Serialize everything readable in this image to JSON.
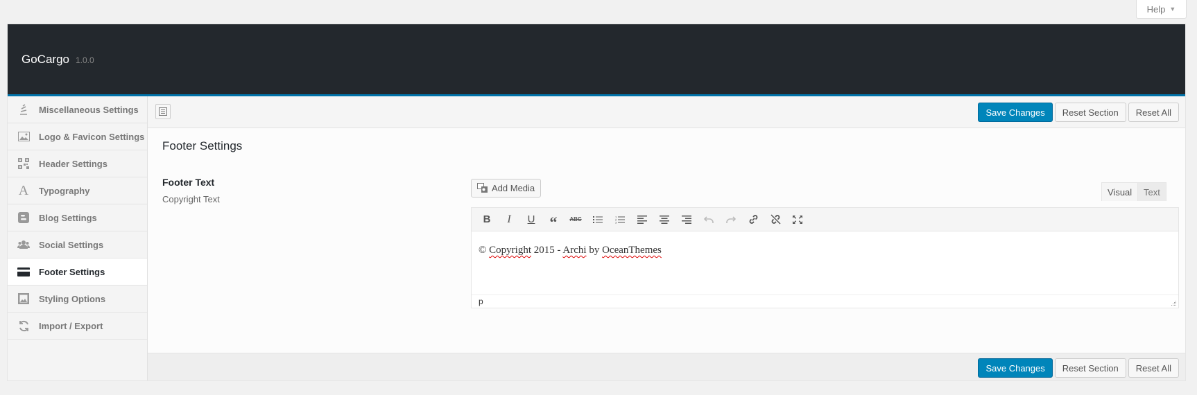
{
  "help": {
    "label": "Help"
  },
  "header": {
    "title": "GoCargo",
    "version": "1.0.0"
  },
  "sidebar": {
    "items": [
      {
        "label": "Miscellaneous Settings",
        "icon": "stack-icon"
      },
      {
        "label": "Logo & Favicon Settings",
        "icon": "image-icon"
      },
      {
        "label": "Header Settings",
        "icon": "qr-icon"
      },
      {
        "label": "Typography",
        "icon": "typography-icon"
      },
      {
        "label": "Blog Settings",
        "icon": "blogger-icon"
      },
      {
        "label": "Social Settings",
        "icon": "users-icon"
      },
      {
        "label": "Footer Settings",
        "icon": "card-icon",
        "active": true
      },
      {
        "label": "Styling Options",
        "icon": "picture-icon"
      },
      {
        "label": "Import / Export",
        "icon": "refresh-icon"
      }
    ]
  },
  "actions": {
    "save": "Save Changes",
    "reset_section": "Reset Section",
    "reset_all": "Reset All"
  },
  "section": {
    "title": "Footer Settings"
  },
  "field": {
    "label": "Footer Text",
    "description": "Copyright Text",
    "add_media": "Add Media",
    "tab_visual": "Visual",
    "tab_text": "Text",
    "content_prefix": "© ",
    "content_w1": "Copyright",
    "content_mid": " 2015 - ",
    "content_w2": "Archi",
    "content_by": " by ",
    "content_w3": "OceanThemes",
    "status_path": "p"
  },
  "colors": {
    "header_bg": "#23282d",
    "accent": "#0073aa",
    "primary_button": "#0085ba"
  }
}
